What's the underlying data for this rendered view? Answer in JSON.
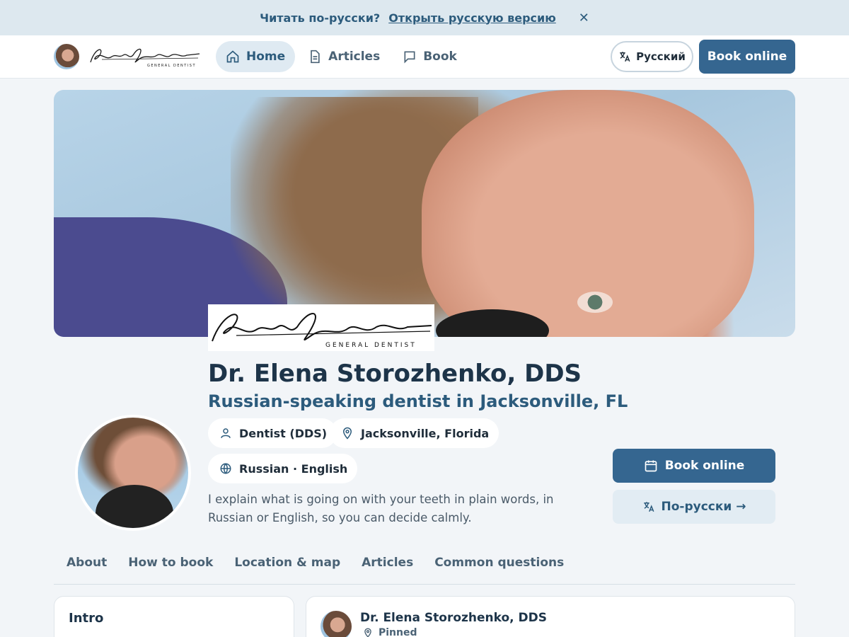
{
  "banner": {
    "prompt": "Читать по-русски?",
    "link": "Открыть русскую версию",
    "close_icon": "close-icon"
  },
  "header": {
    "nav": [
      {
        "label": "Home",
        "icon": "home-icon",
        "active": true
      },
      {
        "label": "Articles",
        "icon": "document-icon",
        "active": false
      },
      {
        "label": "Book",
        "icon": "chat-icon",
        "active": false
      }
    ],
    "language_label": "Русский",
    "book_label": "Book online"
  },
  "profile": {
    "name": "Dr. Elena Storozhenko, DDS",
    "subtitle": "Russian-speaking dentist in Jacksonville, FL",
    "chips": [
      {
        "label": "Dentist (DDS)",
        "icon": "person-icon"
      },
      {
        "label": "Jacksonville, Florida",
        "icon": "location-pin-icon"
      },
      {
        "label": "Russian · English",
        "icon": "globe-icon"
      }
    ],
    "bio": "I explain what is going on with your teeth in plain words, in Russian or English, so you can decide calmly.",
    "cta_book": "Book online",
    "cta_ru": "По-русски →"
  },
  "tabs": [
    "About",
    "How to book",
    "Location & map",
    "Articles",
    "Common questions"
  ],
  "intro_card": {
    "title": "Intro"
  },
  "post_card": {
    "author": "Dr. Elena Storozhenko, DDS",
    "pinned": "Pinned"
  },
  "colors": {
    "accent": "#356690",
    "accent_text": "#2c5b7c",
    "banner_bg": "#dde8ef",
    "page_bg": "#f2f5f8"
  }
}
